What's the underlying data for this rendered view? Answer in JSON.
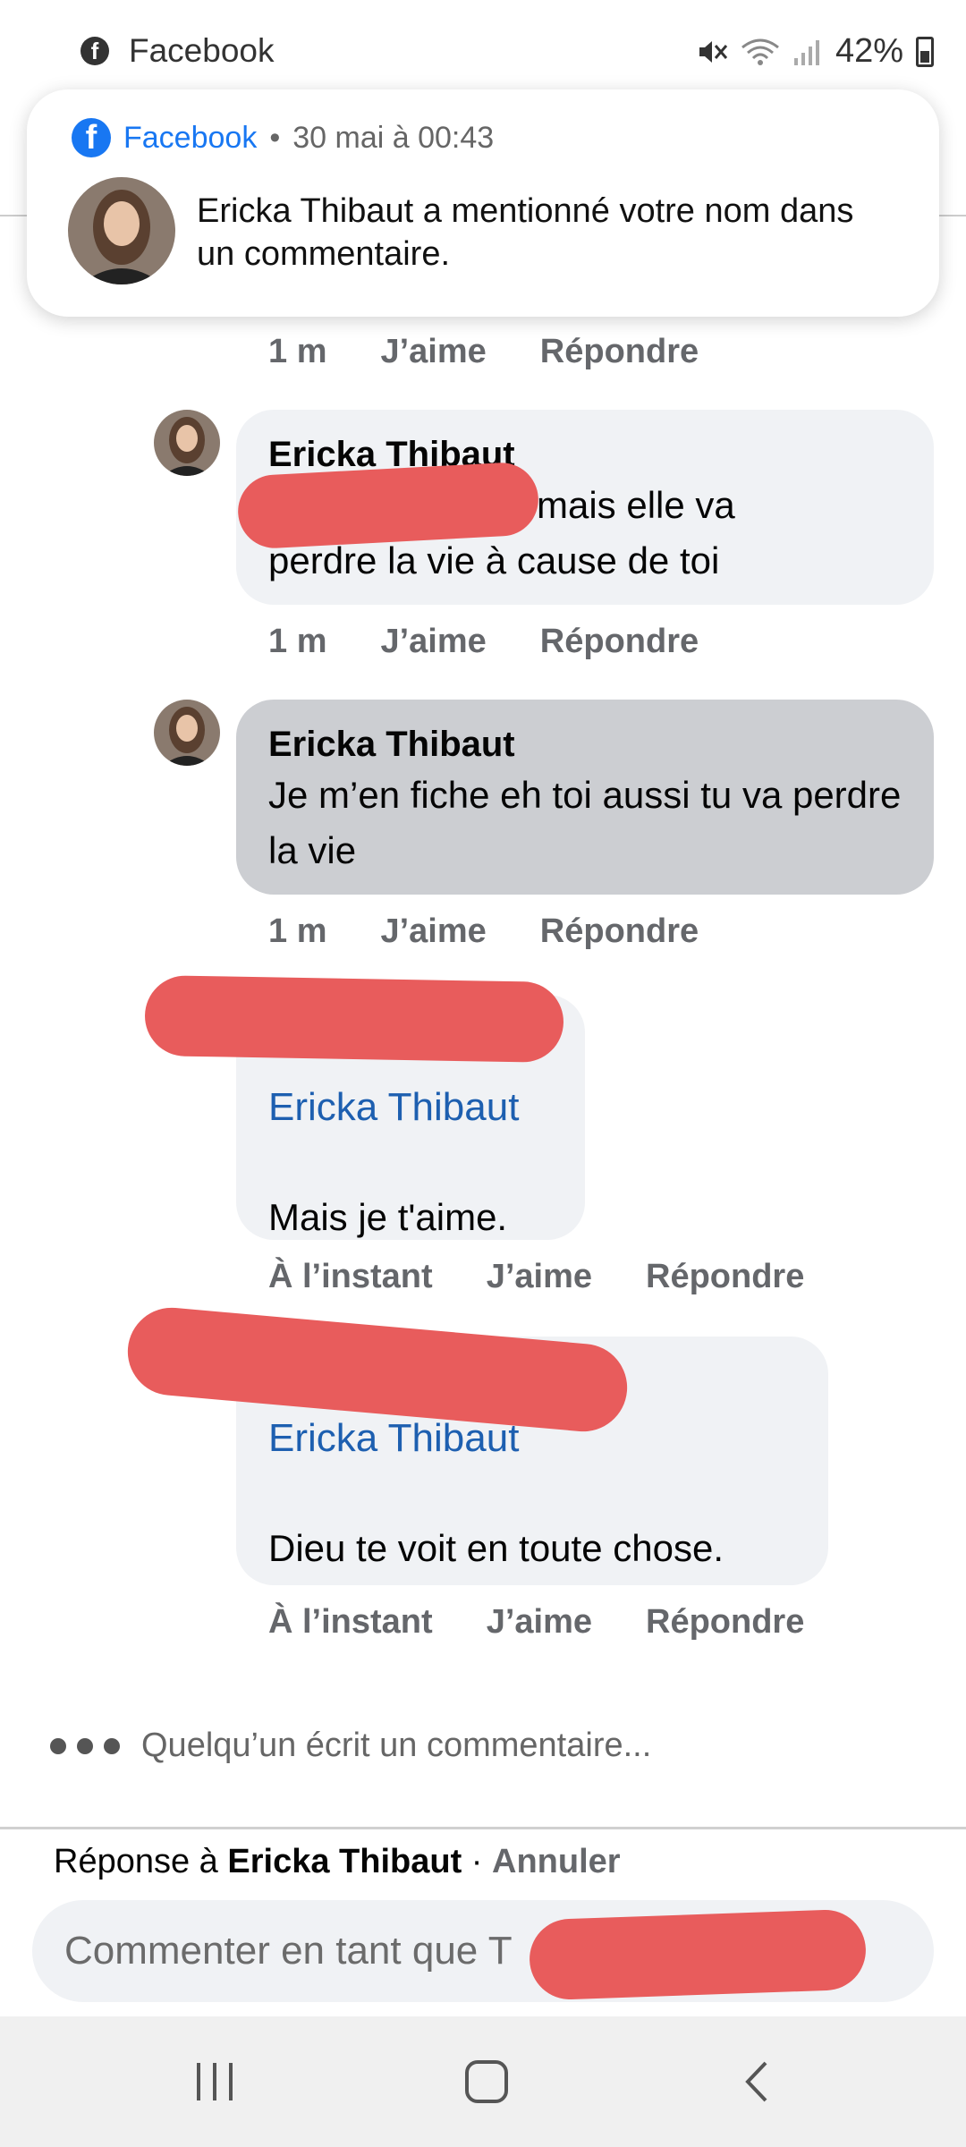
{
  "status_bar": {
    "app_name": "Facebook",
    "battery": "42%",
    "icons": [
      "facebook-icon",
      "mute-icon",
      "wifi-icon",
      "signal-icon",
      "battery-icon"
    ]
  },
  "notification": {
    "app": "Facebook",
    "separator": "•",
    "time": "30 mai à 00:43",
    "text": "Ericka Thibaut a mentionné votre nom dans un commentaire."
  },
  "actions": {
    "like": "J’aime",
    "reply": "Répondre"
  },
  "comments": [
    {
      "time": "1 m"
    },
    {
      "author": "Ericka Thibaut",
      "text_visible": "mais elle va",
      "text_line2": "perdre la vie à cause de toi",
      "time": "1 m"
    },
    {
      "author": "Ericka Thibaut",
      "text": "Je m’en fiche eh toi aussi tu va perdre la vie",
      "time": "1 m"
    },
    {
      "mention": "Ericka Thibaut",
      "text": "Mais je t'aime.",
      "time": "À l’instant"
    },
    {
      "mention": "Ericka Thibaut",
      "text": "Dieu te voit en toute chose.",
      "time": "À l’instant"
    }
  ],
  "typing_indicator": "Quelqu’un écrit un commentaire...",
  "reply_bar": {
    "prefix": "Réponse à",
    "name": "Ericka Thibaut",
    "separator": "·",
    "cancel": "Annuler"
  },
  "composer": {
    "placeholder": "Commenter en tant que T"
  },
  "colors": {
    "facebook_blue": "#1877f2",
    "mention_blue": "#1d5fb0",
    "bubble": "#f0f2f5",
    "selected_bubble": "#ccced2",
    "redaction": "#e85c5c"
  }
}
